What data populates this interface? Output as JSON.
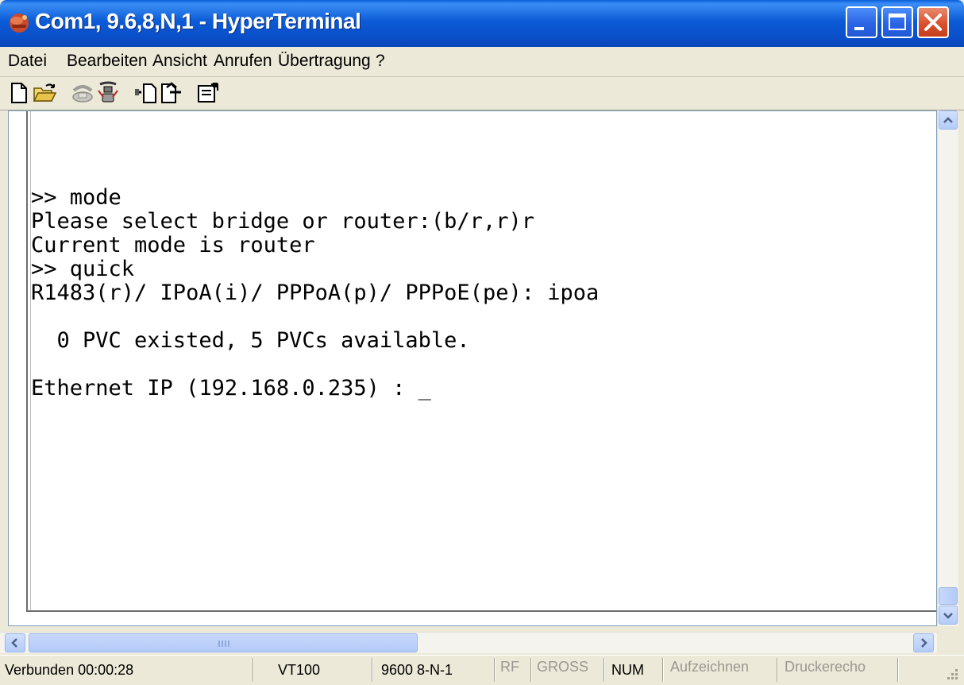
{
  "window": {
    "title": "Com1, 9.6,8,N,1 - HyperTerminal"
  },
  "menu": {
    "items": [
      {
        "label": "Datei"
      },
      {
        "label": "Bearbeiten"
      },
      {
        "label": "Ansicht"
      },
      {
        "label": "Anrufen"
      },
      {
        "label": "Übertragung"
      },
      {
        "label": "?"
      }
    ]
  },
  "toolbar": {
    "icons": [
      "new-document-icon",
      "open-folder-icon",
      "connect-phone-icon",
      "disconnect-icon",
      "send-file-icon",
      "receive-file-icon",
      "properties-icon"
    ]
  },
  "terminal": {
    "lines": [
      ">> mode",
      "Please select bridge or router:(b/r,r)r",
      "Current mode is router",
      ">> quick",
      "R1483(r)/ IPoA(i)/ PPPoA(p)/ PPPoE(pe): ipoa",
      "",
      "  0 PVC existed, 5 PVCs available.",
      "",
      "Ethernet IP (192.168.0.235) : _"
    ]
  },
  "status": {
    "connected": "Verbunden 00:00:28",
    "emulation": "VT100",
    "port_settings": "9600 8-N-1",
    "rf": "RF",
    "gross": "GROSS",
    "num": "NUM",
    "capture": "Aufzeichnen",
    "print_echo": "Druckerecho"
  },
  "colors": {
    "titlebar": "#0A4FC9",
    "window_bg": "#ECE9D8",
    "terminal_bg": "#FFFFFF",
    "close_button": "#D9502E"
  }
}
